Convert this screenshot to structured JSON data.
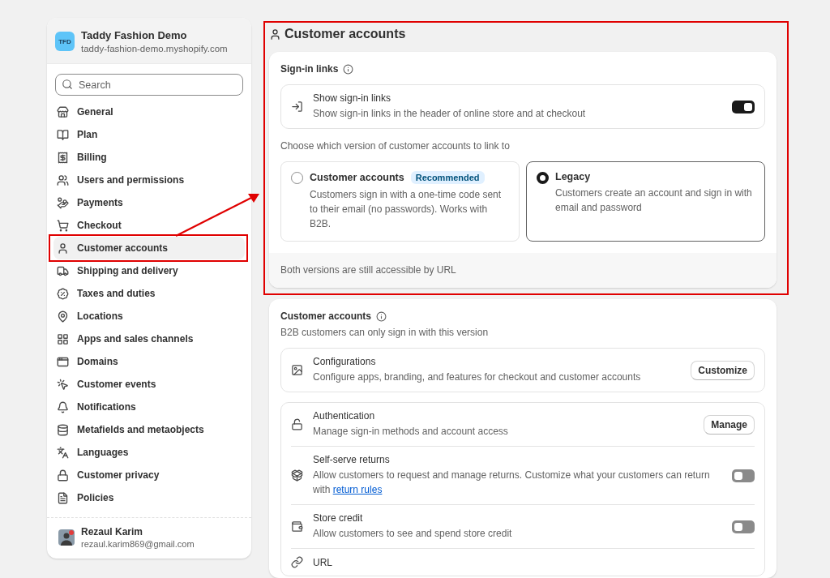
{
  "store": {
    "initials": "TFD",
    "name": "Taddy Fashion Demo",
    "domain": "taddy-fashion-demo.myshopify.com"
  },
  "search": {
    "placeholder": "Search"
  },
  "nav": [
    {
      "label": "General",
      "selected": false
    },
    {
      "label": "Plan",
      "selected": false
    },
    {
      "label": "Billing",
      "selected": false
    },
    {
      "label": "Users and permissions",
      "selected": false
    },
    {
      "label": "Payments",
      "selected": false
    },
    {
      "label": "Checkout",
      "selected": false
    },
    {
      "label": "Customer accounts",
      "selected": true
    },
    {
      "label": "Shipping and delivery",
      "selected": false
    },
    {
      "label": "Taxes and duties",
      "selected": false
    },
    {
      "label": "Locations",
      "selected": false
    },
    {
      "label": "Apps and sales channels",
      "selected": false
    },
    {
      "label": "Domains",
      "selected": false
    },
    {
      "label": "Customer events",
      "selected": false
    },
    {
      "label": "Notifications",
      "selected": false
    },
    {
      "label": "Metafields and metaobjects",
      "selected": false
    },
    {
      "label": "Languages",
      "selected": false
    },
    {
      "label": "Customer privacy",
      "selected": false
    },
    {
      "label": "Policies",
      "selected": false
    }
  ],
  "user": {
    "name": "Rezaul Karim",
    "email": "rezaul.karim869@gmail.com"
  },
  "page_title": "Customer accounts",
  "sign_in": {
    "title": "Sign-in links",
    "toggle": {
      "title": "Show sign-in links",
      "description": "Show sign-in links in the header of online store and at checkout",
      "on": true
    },
    "prompt": "Choose which version of customer accounts to link to",
    "options": [
      {
        "title": "Customer accounts",
        "badge": "Recommended",
        "description": "Customers sign in with a one-time code sent to their email (no passwords). Works with B2B.",
        "selected": false
      },
      {
        "title": "Legacy",
        "description": "Customers create an account and sign in with email and password",
        "selected": true
      }
    ],
    "footer": "Both versions are still accessible by URL"
  },
  "accounts": {
    "title": "Customer accounts",
    "subtitle": "B2B customers can only sign in with this version",
    "groups": [
      [
        {
          "kind": "button",
          "title": "Configurations",
          "description": "Configure apps, branding, and features for checkout and customer accounts",
          "button": "Customize"
        }
      ],
      [
        {
          "kind": "button",
          "title": "Authentication",
          "description": "Manage sign-in methods and account access",
          "button": "Manage"
        },
        {
          "kind": "toggle",
          "title": "Self-serve returns",
          "description": "Allow customers to request and manage returns. Customize what your customers can return with",
          "link": "return rules",
          "on": false
        },
        {
          "kind": "toggle",
          "title": "Store credit",
          "description": "Allow customers to see and spend store credit",
          "on": false
        },
        {
          "kind": "plain",
          "title": "URL"
        }
      ]
    ]
  },
  "annotation": {
    "kind": "arrow-frames"
  }
}
